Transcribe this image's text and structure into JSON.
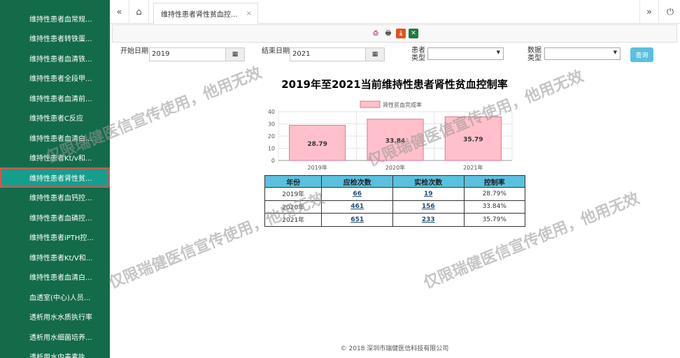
{
  "sidebar": {
    "items": [
      {
        "label": "维持性患者血常规..."
      },
      {
        "label": "维持性患者转铁蛋..."
      },
      {
        "label": "维持性患者血清铁..."
      },
      {
        "label": "维持性患者全段甲..."
      },
      {
        "label": "维持性患者血清前..."
      },
      {
        "label": "维持性患者C反应"
      },
      {
        "label": "维持性患者血清白..."
      },
      {
        "label": "维持性患者Kt/v和..."
      },
      {
        "label": "维持性患者肾性贫...",
        "active": true
      },
      {
        "label": "维持性患者血钙控..."
      },
      {
        "label": "维持性患者血磷控..."
      },
      {
        "label": "维持性患者iPTH控..."
      },
      {
        "label": "维持性患者Kt/V和..."
      },
      {
        "label": "维持性患者血清白..."
      },
      {
        "label": "血透室(中心)人员..."
      },
      {
        "label": "透析用水水质执行率"
      },
      {
        "label": "透析用水细菌培养..."
      },
      {
        "label": "透析用水内毒素执..."
      }
    ]
  },
  "tabs": {
    "active_label": "维持性患者肾性贫血控...",
    "close_glyph": "×",
    "prev_glyph": "«",
    "next_glyph": "»",
    "home_glyph": "⌂",
    "power_glyph": "⏻"
  },
  "filters": {
    "start_label": "开始日期",
    "start_value": "2019",
    "end_label": "结束日期",
    "end_value": "2021",
    "patient_type_label": "患者类型",
    "data_type_label": "数据类型",
    "query_label": "查询"
  },
  "report": {
    "title": "2019年至2021当前维持性患者肾性贫血控制率"
  },
  "chart_data": {
    "type": "bar",
    "categories": [
      "2019年",
      "2020年",
      "2021年"
    ],
    "series": [
      {
        "name": "肾性贫血完成率",
        "values": [
          28.79,
          33.84,
          35.79
        ]
      }
    ],
    "data_labels": [
      "28.79",
      "33.84",
      "35.79"
    ],
    "ylim": [
      0,
      40
    ],
    "yticks": [
      "0",
      "10",
      "20",
      "30",
      "40"
    ],
    "legend": "top",
    "bar_color": "#ffc0cb",
    "bar_border": "#d9788c"
  },
  "table": {
    "headers": [
      "年份",
      "应检次数",
      "实检次数",
      "控制率"
    ],
    "rows": [
      [
        "2019年",
        "66",
        "19",
        "28.79%"
      ],
      [
        "2020年",
        "461",
        "156",
        "33.84%"
      ],
      [
        "2021年",
        "651",
        "233",
        "35.79%"
      ]
    ]
  },
  "footer": "© 2018 深圳市瑞健医信科技有限公司",
  "watermark": "仅限瑞健医信宣传使用，他用无效",
  "colors": {
    "sidebar": "#136b4a",
    "sidebar_active": "#169e8c",
    "accent": "#5bc0de"
  }
}
